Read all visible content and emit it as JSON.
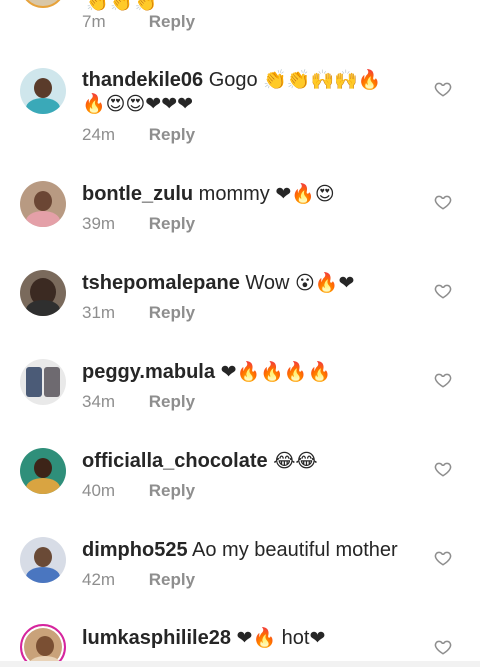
{
  "top_partial": {
    "time": "7m",
    "reply_label": "Reply",
    "emoji": "👏👏👏"
  },
  "comments": [
    {
      "username": "thandekile06",
      "text": "Gogo",
      "emoji": "👏👏🙌🙌🔥",
      "emoji2": "🔥😍😍❤❤❤",
      "time": "24m",
      "reply_label": "Reply"
    },
    {
      "username": "bontle_zulu",
      "text": "mommy",
      "emoji": "❤🔥😍",
      "time": "39m",
      "reply_label": "Reply"
    },
    {
      "username": "tshepomalepane",
      "text": "Wow",
      "emoji": "😮🔥❤",
      "time": "31m",
      "reply_label": "Reply"
    },
    {
      "username": "peggy.mabula",
      "text": "",
      "emoji": "❤🔥🔥🔥🔥",
      "time": "34m",
      "reply_label": "Reply"
    },
    {
      "username": "officialla_chocolate",
      "text": "",
      "emoji": "😂😂",
      "time": "40m",
      "reply_label": "Reply"
    },
    {
      "username": "dimpho525",
      "text": "Ao my beautiful mother",
      "emoji": "",
      "time": "42m",
      "reply_label": "Reply"
    },
    {
      "username": "lumkasphilile28",
      "text": "",
      "emoji": "❤🔥",
      "text2": "hot",
      "emoji3": "❤"
    }
  ],
  "colors": {
    "heart_outline": "#8e8e8e",
    "username": "#262626",
    "meta": "#8e8e8e",
    "story_ring": "#d6249f"
  },
  "icons": {
    "like": "heart-outline-icon"
  }
}
